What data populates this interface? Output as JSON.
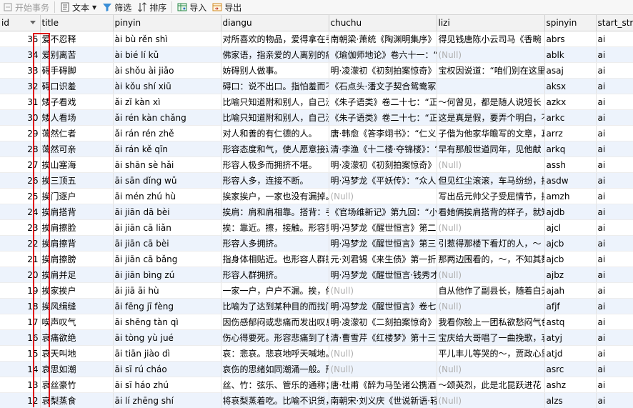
{
  "toolbar": {
    "begin_transaction": "开始事务",
    "text": "文本",
    "filter": "筛选",
    "sort": "排序",
    "import": "导入",
    "export": "导出"
  },
  "columns": [
    "id",
    "title",
    "pinyin",
    "diangu",
    "chuchu",
    "lizi",
    "spinyin",
    "start_str"
  ],
  "rows": [
    {
      "id": "35",
      "title": "爱不忍释",
      "pinyin": "ài bù rěn shì",
      "diangu": "对所喜欢的物品，爱得拿在手",
      "chuchu": "南朝梁·萧统《陶渊明集序》",
      "lizi": "得见钱唐陈小云司马《香畹",
      "spinyin": "abrs",
      "start": "ai"
    },
    {
      "id": "34",
      "title": "爱别离苦",
      "pinyin": "ài bié lí kǔ",
      "diangu": "佛家语，指亲爱的人离别的痛",
      "chuchu": "《瑜伽师地论》卷六十一：“",
      "lizi": "(Null)",
      "spinyin": "ablk",
      "start": "ai"
    },
    {
      "id": "33",
      "title": "碍手碍脚",
      "pinyin": "ài shǒu ài jiǎo",
      "diangu": "妨碍别人做事。",
      "chuchu": "明·凌濛初《初刻拍案惊奇》",
      "lizi": "宝权因说道：“咱们别在这里",
      "spinyin": "asaj",
      "start": "ai"
    },
    {
      "id": "32",
      "title": "碍口识羞",
      "pinyin": "ài kǒu shí xiū",
      "diangu": "碍口：说不出口。指怕羞而不",
      "chuchu": "《石点头·潘文子契合鸳鸯冢》",
      "lizi": "",
      "spinyin": "aksx",
      "start": "ai"
    },
    {
      "id": "31",
      "title": "矮子看戏",
      "pinyin": "ǎi zǐ kàn xì",
      "diangu": "比喻只知道附和别人，自己没",
      "chuchu": "《朱子语类》卷二十七：“正",
      "lizi": "～何曾见，都是随人说短长",
      "spinyin": "azkx",
      "start": "ai"
    },
    {
      "id": "30",
      "title": "矮人看场",
      "pinyin": "ǎi rén kàn chǎng",
      "diangu": "比喻只知道附和别人，自己没",
      "chuchu": "《朱子语类》卷二十七：“正",
      "lizi": "这是真是假，要弄个明白，不",
      "spinyin": "arkc",
      "start": "ai"
    },
    {
      "id": "29",
      "title": "蔼然仁者",
      "pinyin": "ǎi rán rén zhě",
      "diangu": "对人和善的有仁德的人。",
      "chuchu": "唐·韩愈《答李翊书》：“仁义",
      "lizi": "子偕为他家华瞻写的文章，真",
      "spinyin": "arrz",
      "start": "ai"
    },
    {
      "id": "28",
      "title": "蔼然可亲",
      "pinyin": "ǎi rán kě qīn",
      "diangu": "形容态度和气，使人愿意接近",
      "chuchu": "清·李渔《十二楼·夺锦楼》：“",
      "lizi": "早有那般世道同年，见他献",
      "spinyin": "arkq",
      "start": "ai"
    },
    {
      "id": "27",
      "title": "挨山塞海",
      "pinyin": "āi shān sè hǎi",
      "diangu": "形容人极多而拥挤不堪。",
      "chuchu": "明·凌濛初《初刻拍案惊奇》",
      "lizi": "(Null)",
      "spinyin": "assh",
      "start": "ai"
    },
    {
      "id": "26",
      "title": "挨三顶五",
      "pinyin": "āi sān dǐng wǔ",
      "diangu": "形容人多，连接不断。",
      "chuchu": "明·冯梦龙《平妖传》：“众人",
      "lizi": "但见红尘滚滚，车马纷纷，挨",
      "spinyin": "asdw",
      "start": "ai"
    },
    {
      "id": "25",
      "title": "挨门逐户",
      "pinyin": "āi mén zhú hù",
      "diangu": "挨家挨户，一家也没有漏掉。",
      "chuchu": "(Null)",
      "lizi": "写出岳元帅父子受屈情节，挨",
      "spinyin": "amzh",
      "start": "ai"
    },
    {
      "id": "24",
      "title": "挨肩搭背",
      "pinyin": "āi jiān dā bèi",
      "diangu": "挨肩：肩和肩相靠。搭背：手",
      "chuchu": "《官场维新记》第九回：“小",
      "lizi": "看她俩挨肩搭背的样子，就知",
      "spinyin": "ajdb",
      "start": "ai"
    },
    {
      "id": "23",
      "title": "挨肩擦脸",
      "pinyin": "āi jiān cā liǎn",
      "diangu": "挨：靠近。擦，接触。形容男",
      "chuchu": "明·冯梦龙《醒世恒言》第二",
      "lizi": "(Null)",
      "spinyin": "ajcl",
      "start": "ai"
    },
    {
      "id": "22",
      "title": "挨肩擦背",
      "pinyin": "āi jiān cā bèi",
      "diangu": "形容人多拥挤。",
      "chuchu": "明·冯梦龙《醒世恒言》第三",
      "lizi": "引惹得那楼下看灯的人，～",
      "spinyin": "ajcb",
      "start": "ai"
    },
    {
      "id": "21",
      "title": "挨肩擦膀",
      "pinyin": "āi jiān cā bǎng",
      "diangu": "指身体相贴近。也形容人群拥",
      "chuchu": "元·刘君锡《来生债》第一折",
      "lizi": "那两边围看的，～，不知其数",
      "spinyin": "ajcb",
      "start": "ai"
    },
    {
      "id": "20",
      "title": "挨肩并足",
      "pinyin": "āi jiān bìng zú",
      "diangu": "形容人群拥挤。",
      "chuchu": "明·冯梦龙《醒世恒言·钱秀才",
      "lizi": "(Null)",
      "spinyin": "ajbz",
      "start": "ai"
    },
    {
      "id": "19",
      "title": "挨家挨户",
      "pinyin": "āi jiā āi hù",
      "diangu": "一家一户，户户不漏。挨，依",
      "chuchu": "(Null)",
      "lizi": "自从他作了副县长，随着白天",
      "spinyin": "ajah",
      "start": "ai"
    },
    {
      "id": "18",
      "title": "挨风缉缝",
      "pinyin": "āi fēng jī fèng",
      "diangu": "比喻为了达到某种目的而找门",
      "chuchu": "明·冯梦龙《醒世恒言》卷七",
      "lizi": "(Null)",
      "spinyin": "afjf",
      "start": "ai"
    },
    {
      "id": "17",
      "title": "唉声叹气",
      "pinyin": "āi shēng tàn qì",
      "diangu": "因伤感郁闷或悲痛而发出叹息",
      "chuchu": "明·凌濛初《二刻拍案惊奇》",
      "lizi": "我看你脸上一团私欲愁闷气色",
      "spinyin": "astq",
      "start": "ai"
    },
    {
      "id": "16",
      "title": "哀痛欲绝",
      "pinyin": "āi tòng yù jué",
      "diangu": "伤心得要死。形容悲痛到了极",
      "chuchu": "清·曹雪芹《红楼梦》第十三",
      "lizi": "宝庆给大哥唱了一曲挽歌，哀",
      "spinyin": "atyj",
      "start": "ai"
    },
    {
      "id": "15",
      "title": "哀天叫地",
      "pinyin": "āi tiān jiào dì",
      "diangu": "哀：悲哀。悲哀地呼天喊地。",
      "chuchu": "(Null)",
      "lizi": "平儿丰儿等哭的～，贾政心里",
      "spinyin": "atjd",
      "start": "ai"
    },
    {
      "id": "14",
      "title": "哀思如潮",
      "pinyin": "āi sī rú cháo",
      "diangu": "哀伤的思绪如同潮涌一般。形",
      "chuchu": "(Null)",
      "lizi": "(Null)",
      "spinyin": "asrc",
      "start": "ai"
    },
    {
      "id": "13",
      "title": "哀丝豪竹",
      "pinyin": "āi sī háo zhú",
      "diangu": "丝、竹：弦乐、管乐的通称；",
      "chuchu": "唐·杜甫《醉为马坠诸公携酒",
      "lizi": "～颂英烈，此是北昆跃进花",
      "spinyin": "ashz",
      "start": "ai"
    },
    {
      "id": "12",
      "title": "哀梨蒸食",
      "pinyin": "āi lí zhēng shí",
      "diangu": "将哀梨蒸着吃。比喻不识货，",
      "chuchu": "南朝宋·刘义庆《世说新语·轻",
      "lizi": "(Null)",
      "spinyin": "alzs",
      "start": "ai"
    }
  ]
}
